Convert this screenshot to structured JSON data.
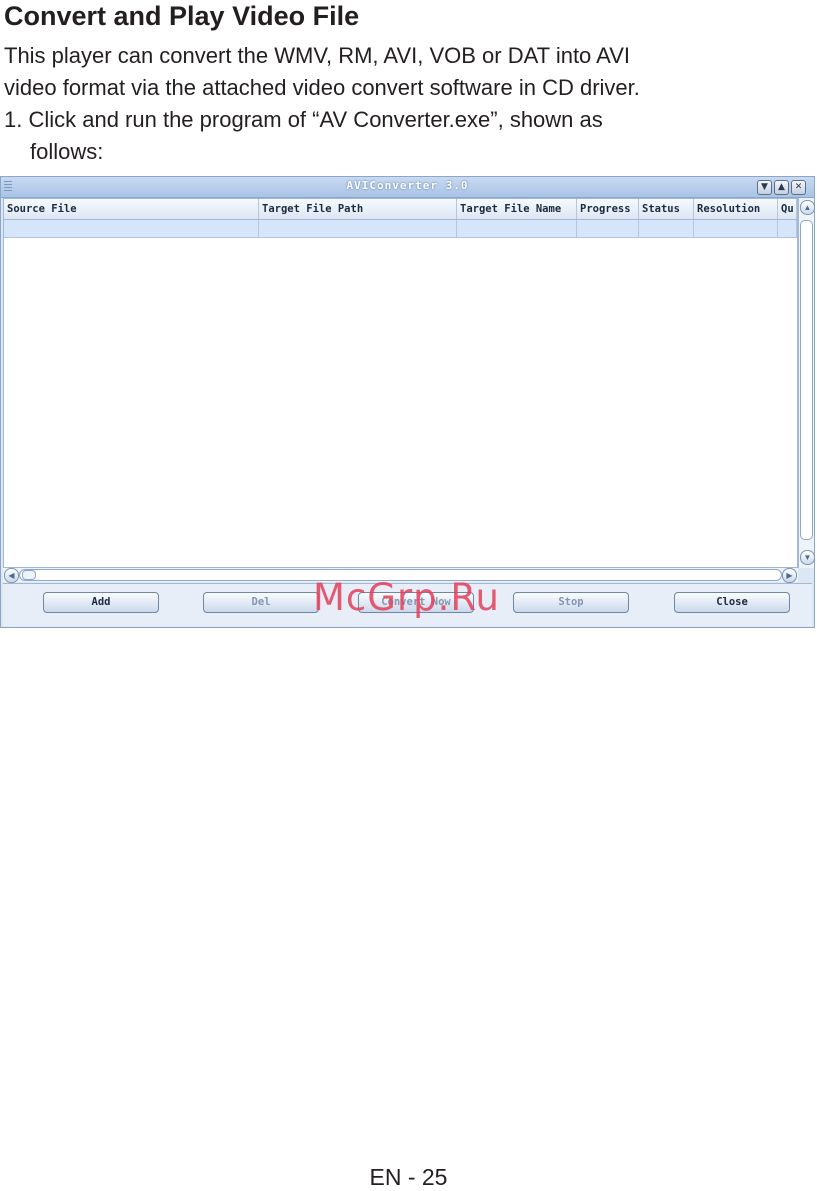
{
  "document": {
    "heading": "Convert and Play Video File",
    "intro_line1": "This player can convert the WMV, RM, AVI, VOB or DAT into AVI",
    "intro_line2": "video format via the attached video convert software in CD driver.",
    "step1_line1": "1. Click and run the program of “AV Converter.exe”, shown as",
    "step1_line2": "follows:",
    "page_number": "EN - 25"
  },
  "app": {
    "title": "AVIConverter 3.0",
    "window_buttons": {
      "minimize": "▼",
      "maximize": "▲",
      "close": "✕"
    },
    "columns": [
      "Source File",
      "Target File Path",
      "Target File Name",
      "Progress",
      "Status",
      "Resolution",
      "Qu"
    ],
    "buttons": {
      "add": "Add",
      "del": "Del",
      "convert": "Convert Now",
      "stop": "Stop",
      "close": "Close"
    }
  },
  "watermark": "McGrp.Ru"
}
